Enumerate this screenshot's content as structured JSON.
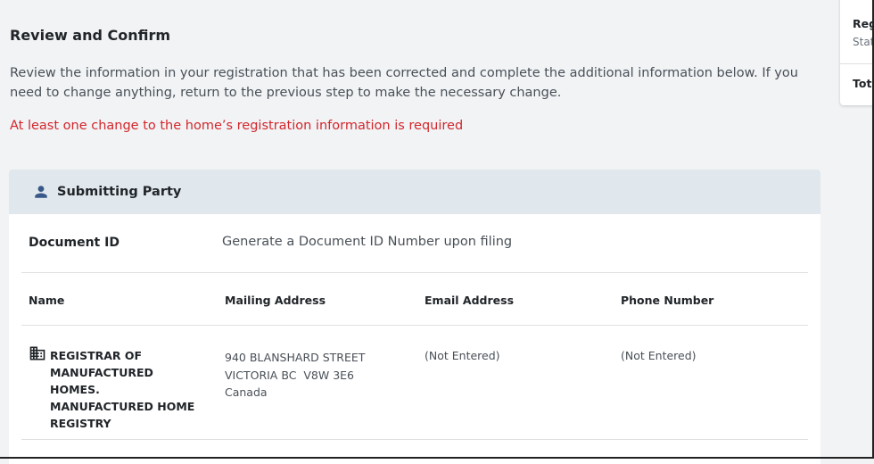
{
  "review": {
    "title": "Review and Confirm",
    "description": "Review the information in your registration that has been corrected and complete the additional information below. If you need to change anything, return to the previous step to make the necessary change.",
    "error": "At least one change to the home’s registration information is required"
  },
  "submitting_party": {
    "title": "Submitting Party",
    "icon": "person-icon",
    "document_id_label": "Document ID",
    "document_id_value": "Generate a Document ID Number upon filing",
    "columns": {
      "name": "Name",
      "mailing_address": "Mailing Address",
      "email": "Email Address",
      "phone": "Phone Number"
    },
    "party": {
      "icon": "business-icon",
      "name": "REGISTRAR OF MANUFACTURED HOMES. MANUFACTURED HOME REGISTRY",
      "address_line1": "940 BLANSHARD STREET",
      "address_line2": "VICTORIA BC  V8W 3E6",
      "address_line3": "Canada",
      "email": "(Not Entered)",
      "phone": "(Not Entered)"
    }
  },
  "sidebar": {
    "heading": "Reg",
    "status": "Stat",
    "total": "Tota"
  },
  "colors": {
    "error": "#d3272c",
    "header_bg": "#e0e7ed",
    "icon": "#38598a"
  }
}
